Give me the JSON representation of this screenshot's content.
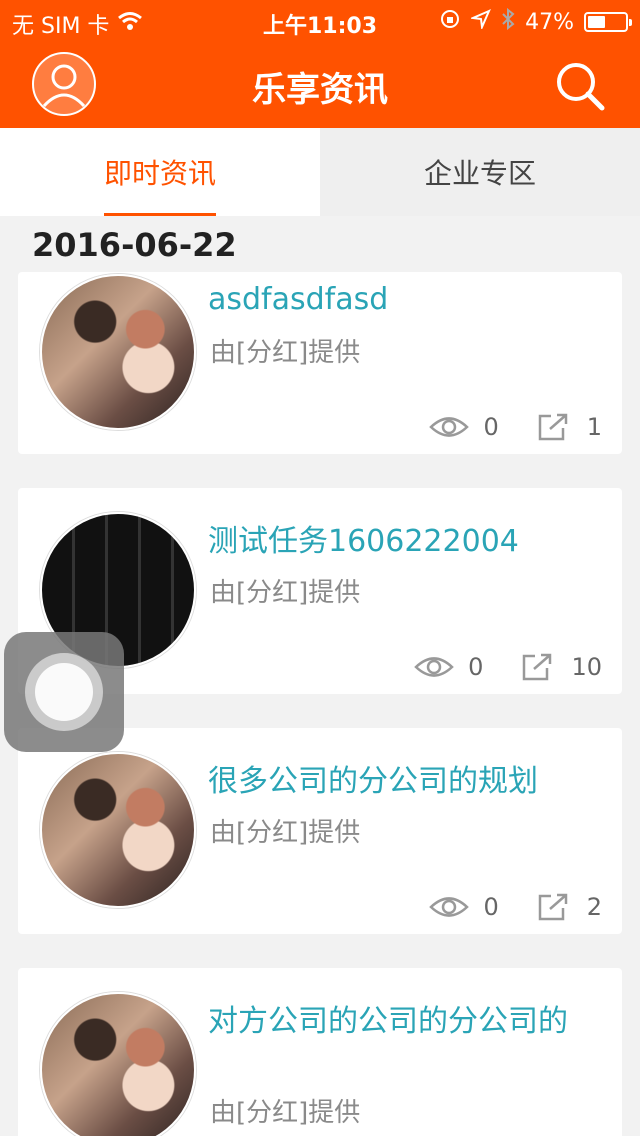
{
  "status_bar": {
    "carrier": "无 SIM 卡",
    "time": "上午11:03",
    "battery": "47%",
    "battery_level": 0.47,
    "icons": [
      "wifi-icon",
      "rotation-lock-icon",
      "location-icon",
      "bluetooth-icon",
      "battery-icon"
    ]
  },
  "nav": {
    "title": "乐享资讯",
    "left_icon": "user-avatar-icon",
    "right_icon": "search-icon",
    "color": "#ff5200"
  },
  "tabs": [
    {
      "label": "即时资讯",
      "active": true
    },
    {
      "label": "企业专区",
      "active": false
    }
  ],
  "feed": {
    "date": "2016-06-22",
    "items": [
      {
        "title": "asdfasdfasd",
        "source": "由[分红]提供",
        "views": "0",
        "shares": "1",
        "thumb": "photo"
      },
      {
        "title": "测试任务1606222004",
        "source": "由[分红]提供",
        "views": "0",
        "shares": "10",
        "thumb": "keyboard"
      },
      {
        "title": "很多公司的分公司的规划",
        "source": "由[分红]提供",
        "views": "0",
        "shares": "2",
        "thumb": "photo"
      },
      {
        "title": "对方公司的公司的分公司的",
        "source": "由[分红]提供",
        "views": "",
        "shares": "",
        "thumb": "photo"
      }
    ]
  },
  "colors": {
    "accent": "#ff5200",
    "title_teal": "#2aa4b6",
    "source_gray": "#8a8a8a",
    "background": "#f2f2f2"
  }
}
